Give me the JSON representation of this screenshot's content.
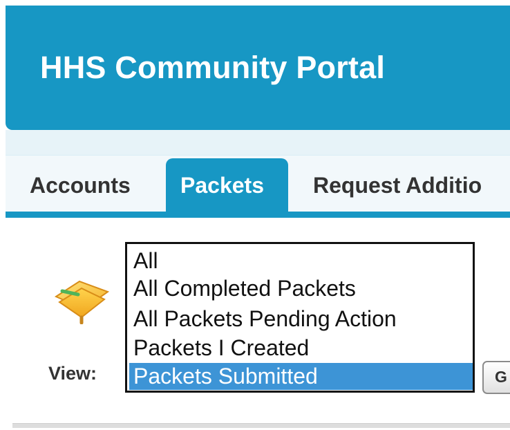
{
  "header": {
    "title": "HHS Community Portal",
    "background_color": "#1797c4"
  },
  "tabs": [
    {
      "label": "Accounts",
      "active": false
    },
    {
      "label": "Packets",
      "active": true
    },
    {
      "label": "Request Additio",
      "active": false
    }
  ],
  "page": {
    "icon": "packet-folder-icon"
  },
  "view": {
    "label": "View:",
    "options": [
      {
        "label": "All",
        "selected": false
      },
      {
        "label": "All Completed Packets",
        "selected": false
      },
      {
        "label": "All Packets Pending Action",
        "selected": false
      },
      {
        "label": "Packets I Created",
        "selected": false
      },
      {
        "label": "Packets Submitted",
        "selected": true
      }
    ],
    "go_button_label": "G"
  },
  "colors": {
    "accent": "#1797c4",
    "selected_option": "#3d94d6"
  }
}
